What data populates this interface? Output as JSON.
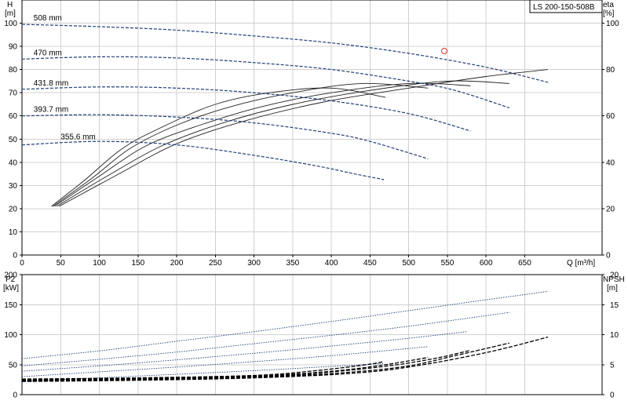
{
  "title": "LS 200-150-508B",
  "chart_data": [
    {
      "type": "line",
      "name": "head-efficiency",
      "xlabel": "Q [m³/h]",
      "ylabel": [
        "H",
        "[m]"
      ],
      "y2label": [
        "eta",
        "[%]"
      ],
      "xlim": [
        0,
        750
      ],
      "ylim": [
        0,
        110
      ],
      "y2lim": [
        0,
        110
      ],
      "xticks": [
        0,
        50,
        100,
        150,
        200,
        250,
        300,
        350,
        400,
        450,
        500,
        550,
        600,
        650
      ],
      "yticks": [
        0,
        10,
        20,
        30,
        40,
        50,
        60,
        70,
        80,
        90,
        100
      ],
      "y2ticks": [
        0,
        20,
        40,
        60,
        80,
        100
      ],
      "grid": true,
      "head_curves": [
        {
          "name": "508 mm",
          "x": [
            0,
            100,
            200,
            300,
            400,
            500,
            600,
            680
          ],
          "y": [
            99.5,
            98.5,
            97.0,
            94.5,
            91.5,
            87.0,
            81.0,
            74.5
          ]
        },
        {
          "name": "470 mm",
          "x": [
            0,
            100,
            200,
            300,
            400,
            500,
            560,
            630
          ],
          "y": [
            84.5,
            85.5,
            85.0,
            83.0,
            80.0,
            75.0,
            71.0,
            63.5
          ]
        },
        {
          "name": "431.8 mm",
          "x": [
            0,
            100,
            200,
            300,
            400,
            500,
            580
          ],
          "y": [
            71.5,
            72.5,
            72.0,
            70.0,
            66.5,
            61.0,
            53.5
          ]
        },
        {
          "name": "393.7 mm",
          "x": [
            0,
            100,
            200,
            300,
            400,
            450,
            525
          ],
          "y": [
            60.0,
            60.5,
            59.5,
            57.0,
            52.5,
            49.0,
            41.5
          ]
        },
        {
          "name": "355.6 mm",
          "x": [
            0,
            100,
            200,
            300,
            380,
            430,
            468
          ],
          "y": [
            47.5,
            49.0,
            47.5,
            43.0,
            38.5,
            35.0,
            32.5
          ]
        }
      ],
      "efficiency_curves": [
        {
          "x": [
            38,
            80,
            130,
            180,
            250,
            320,
            400,
            470
          ],
          "y": [
            21,
            32,
            46,
            55,
            65,
            70,
            72,
            68
          ]
        },
        {
          "x": [
            40,
            90,
            140,
            200,
            270,
            350,
            440,
            525
          ],
          "y": [
            21,
            33,
            46,
            56,
            64,
            70,
            74,
            72
          ]
        },
        {
          "x": [
            42,
            100,
            160,
            230,
            310,
            400,
            500,
            580
          ],
          "y": [
            21,
            34,
            47,
            56,
            64,
            70,
            74,
            73
          ]
        },
        {
          "x": [
            45,
            110,
            180,
            260,
            350,
            450,
            550,
            630
          ],
          "y": [
            21,
            34,
            47,
            57,
            65,
            71,
            75,
            74
          ]
        },
        {
          "x": [
            48,
            120,
            200,
            290,
            390,
            500,
            600,
            680
          ],
          "y": [
            21,
            34,
            48,
            58,
            66,
            72,
            77,
            80
          ]
        }
      ],
      "duty_point": {
        "x": 546,
        "y": 88
      }
    },
    {
      "type": "line",
      "name": "power-npsh",
      "xlabel": "",
      "ylabel": [
        "P2",
        "[kW]"
      ],
      "y2label": [
        "NPSH",
        "[m]"
      ],
      "xlim": [
        0,
        750
      ],
      "ylim": [
        0,
        200
      ],
      "y2lim": [
        0,
        20
      ],
      "yticks": [
        0,
        50,
        100,
        150,
        200
      ],
      "y2ticks": [
        0,
        5,
        10,
        15,
        20
      ],
      "grid": true,
      "power_curves": [
        {
          "x": [
            0,
            100,
            200,
            300,
            400,
            500,
            600,
            680
          ],
          "y": [
            60,
            73,
            89,
            105,
            122,
            140,
            158,
            172
          ]
        },
        {
          "x": [
            0,
            100,
            200,
            300,
            400,
            500,
            630
          ],
          "y": [
            48,
            59,
            71,
            85,
            99,
            114,
            137
          ]
        },
        {
          "x": [
            0,
            100,
            200,
            300,
            400,
            500,
            575
          ],
          "y": [
            39,
            48,
            58,
            69,
            81,
            94,
            105
          ]
        },
        {
          "x": [
            0,
            100,
            200,
            300,
            400,
            525
          ],
          "y": [
            30,
            38,
            46,
            55,
            65,
            80
          ]
        },
        {
          "x": [
            0,
            100,
            200,
            300,
            400,
            468
          ],
          "y": [
            22,
            28,
            34,
            40,
            47,
            52
          ]
        }
      ],
      "npsh_curves": [
        {
          "x": [
            0,
            150,
            300,
            420,
            500,
            600,
            680
          ],
          "y": [
            2.2,
            2.4,
            2.8,
            3.5,
            4.6,
            7.0,
            9.6
          ]
        },
        {
          "x": [
            0,
            150,
            300,
            420,
            500,
            560,
            630
          ],
          "y": [
            2.3,
            2.5,
            2.9,
            3.7,
            4.8,
            6.5,
            8.6
          ]
        },
        {
          "x": [
            0,
            150,
            300,
            400,
            480,
            540,
            580
          ],
          "y": [
            2.4,
            2.6,
            3.0,
            3.8,
            4.9,
            6.2,
            7.4
          ]
        },
        {
          "x": [
            0,
            150,
            300,
            400,
            470,
            525
          ],
          "y": [
            2.5,
            2.7,
            3.1,
            3.9,
            5.0,
            6.2
          ]
        },
        {
          "x": [
            0,
            150,
            300,
            380,
            440,
            468
          ],
          "y": [
            2.6,
            2.8,
            3.2,
            4.0,
            4.9,
            5.5
          ]
        }
      ]
    }
  ]
}
